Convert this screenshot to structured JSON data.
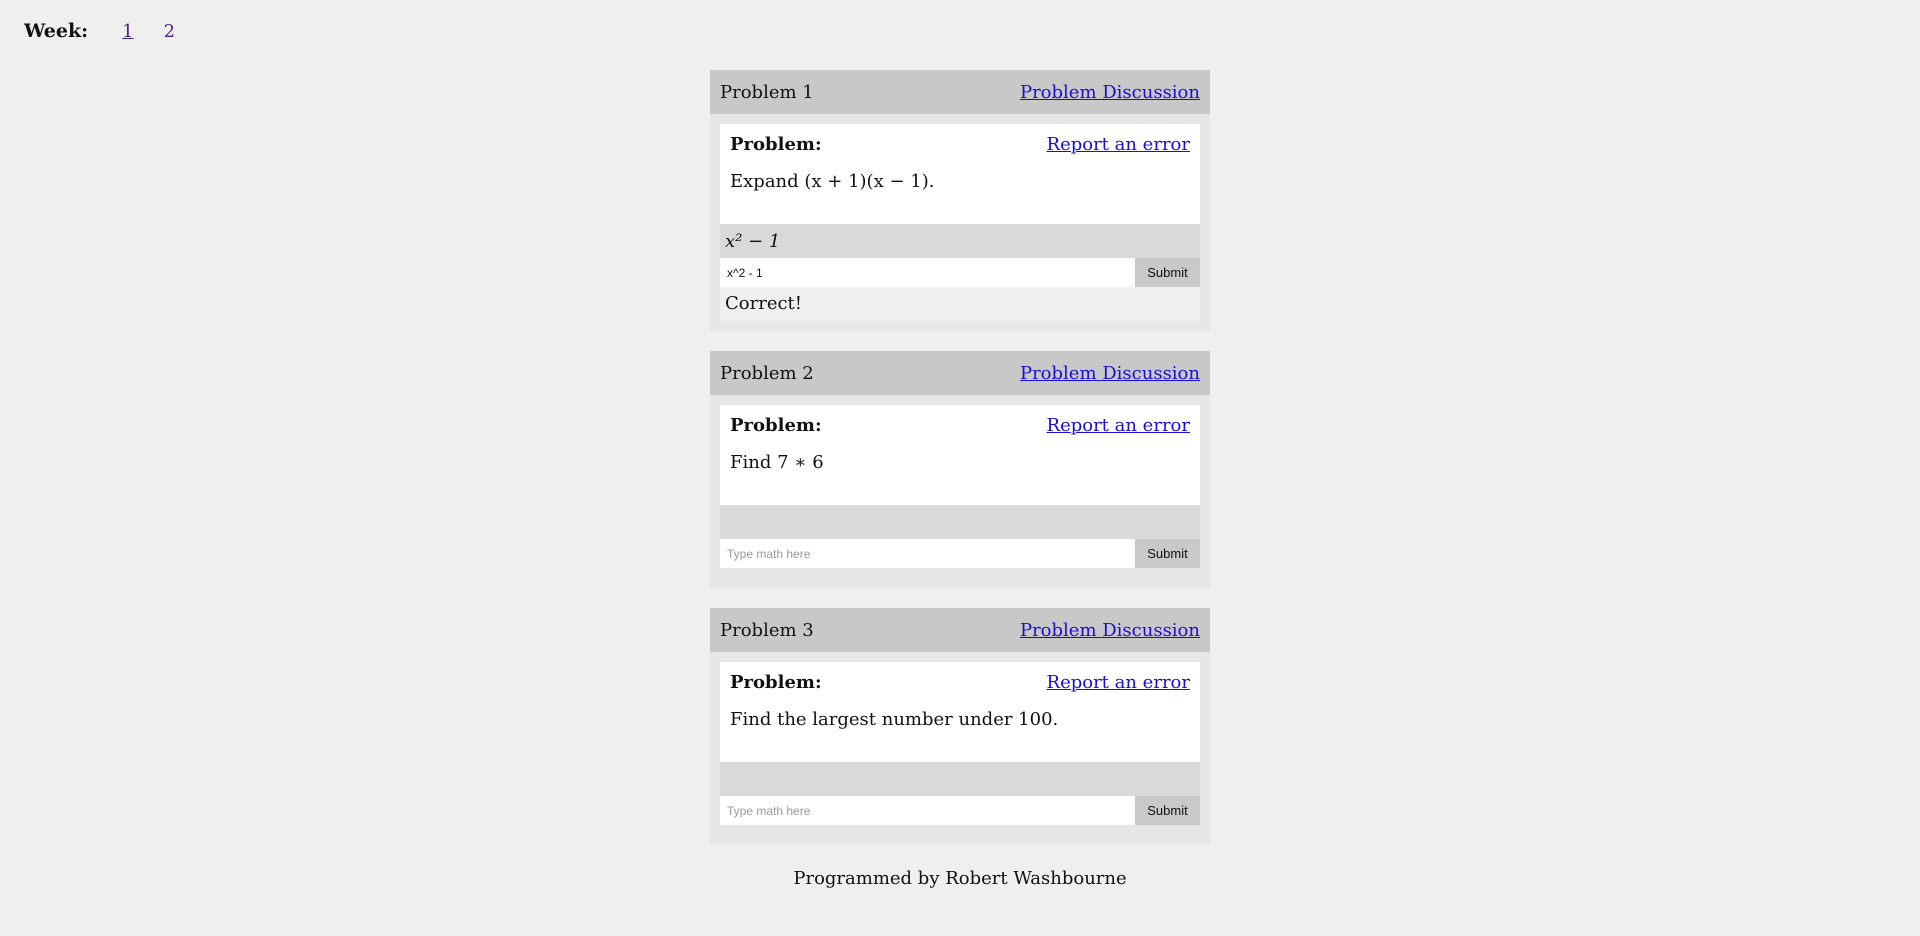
{
  "week_nav": {
    "label": "Week:",
    "weeks": [
      "1",
      "2"
    ]
  },
  "problems": [
    {
      "title": "Problem 1",
      "discussion_link": "Problem Discussion",
      "problem_label": "Problem:",
      "report_link": "Report an error",
      "statement": "Expand (x + 1)(x − 1).",
      "preview": "x² − 1",
      "input_value": "x^2 - 1",
      "input_placeholder": "Type math here",
      "submit_label": "Submit",
      "feedback": "Correct!"
    },
    {
      "title": "Problem 2",
      "discussion_link": "Problem Discussion",
      "problem_label": "Problem:",
      "report_link": "Report an error",
      "statement": "Find 7 ∗ 6",
      "preview": "",
      "input_value": "",
      "input_placeholder": "Type math here",
      "submit_label": "Submit",
      "feedback": ""
    },
    {
      "title": "Problem 3",
      "discussion_link": "Problem Discussion",
      "problem_label": "Problem:",
      "report_link": "Report an error",
      "statement": "Find the largest number under 100.",
      "preview": "",
      "input_value": "",
      "input_placeholder": "Type math here",
      "submit_label": "Submit",
      "feedback": ""
    }
  ],
  "footer": "Programmed by Robert Washbourne",
  "colors": {
    "page_bg": "#efefef",
    "header_bg": "#c8c8c8",
    "link": "#1a0dd6",
    "week_link": "#4b1f8c"
  }
}
